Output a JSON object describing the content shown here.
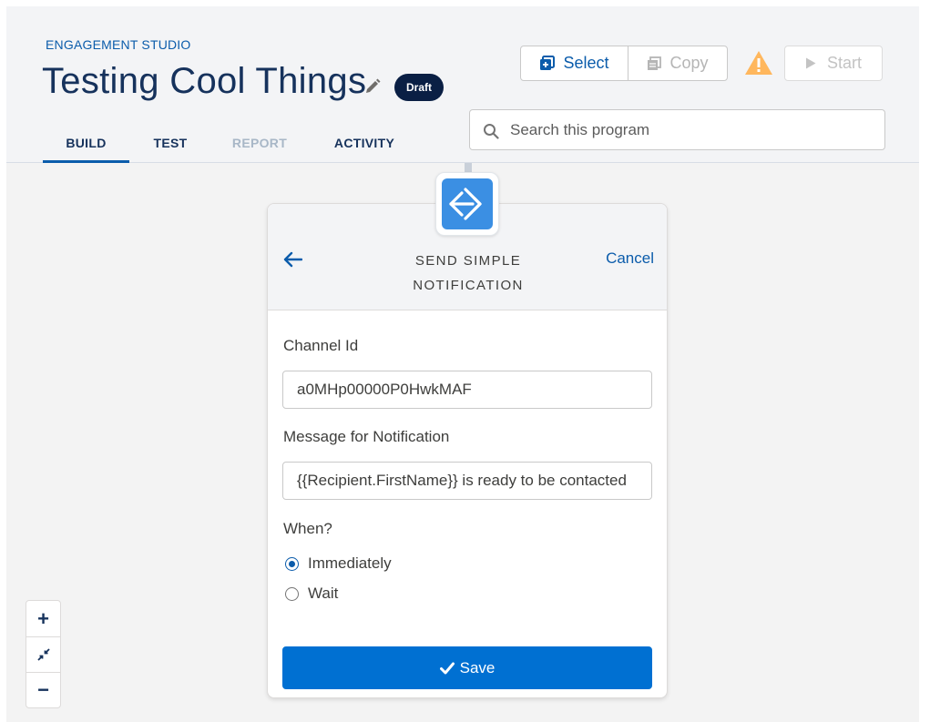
{
  "header": {
    "eyebrow": "ENGAGEMENT STUDIO",
    "title": "Testing Cool Things",
    "badge": "Draft",
    "tabs": [
      {
        "label": "BUILD",
        "state": "active"
      },
      {
        "label": "TEST",
        "state": "normal"
      },
      {
        "label": "REPORT",
        "state": "disabled"
      },
      {
        "label": "ACTIVITY",
        "state": "normal"
      }
    ],
    "actions": {
      "select_label": "Select",
      "copy_label": "Copy",
      "start_label": "Start"
    },
    "search": {
      "placeholder": "Search this program",
      "value": ""
    }
  },
  "panel": {
    "title": "SEND SIMPLE NOTIFICATION",
    "cancel_label": "Cancel",
    "fields": {
      "channel_label": "Channel Id",
      "channel_value": "a0MHp00000P0HwkMAF",
      "message_label": "Message for Notification",
      "message_value": "{{Recipient.FirstName}} is ready to be contacted"
    },
    "when": {
      "label": "When?",
      "options": [
        {
          "label": "Immediately",
          "checked": true
        },
        {
          "label": "Wait",
          "checked": false
        }
      ]
    },
    "save_label": "Save"
  },
  "zoom_controls": {
    "zoom_in": "+",
    "zoom_out": "−"
  },
  "icons": {
    "select": "select-icon",
    "copy": "copy-icon",
    "warning": "warning-icon",
    "start": "play-icon",
    "search": "search-icon",
    "edit": "pencil-icon",
    "node": "send-notification-icon",
    "back": "back-arrow-icon",
    "save": "check-icon",
    "fit": "fit-to-screen-icon"
  },
  "colors": {
    "brand": "#0070d2",
    "link": "#0b5cab",
    "title": "#16325c",
    "warning": "#ffb75d",
    "node": "#3b8fe3",
    "badge": "#0a1f44"
  }
}
